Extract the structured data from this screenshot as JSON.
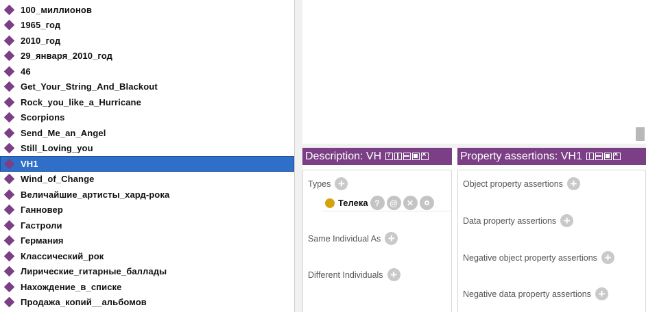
{
  "individuals": [
    {
      "label": "100_миллионов"
    },
    {
      "label": "1965_год"
    },
    {
      "label": "2010_год"
    },
    {
      "label": "29_января_2010_год"
    },
    {
      "label": "46"
    },
    {
      "label": "Get_Your_String_And_Blackout"
    },
    {
      "label": "Rock_you_like_a_Hurricane"
    },
    {
      "label": "Scorpions"
    },
    {
      "label": "Send_Me_an_Angel"
    },
    {
      "label": "Still_Loving_you"
    },
    {
      "label": "VH1",
      "selected": true
    },
    {
      "label": "Wind_of_Change"
    },
    {
      "label": "Величайшие_артисты_хард-рока"
    },
    {
      "label": "Ганновер"
    },
    {
      "label": "Гастроли"
    },
    {
      "label": "Германия"
    },
    {
      "label": "Классический_рок"
    },
    {
      "label": "Лирические_гитарные_баллады"
    },
    {
      "label": "Нахождение_в_списке"
    },
    {
      "label": "Продажа_копий__альбомов"
    }
  ],
  "description_view": {
    "title": "Description: VH",
    "types_label": "Types",
    "type_entry": "Телека",
    "same_individual_label": "Same Individual As",
    "different_individuals_label": "Different Individuals"
  },
  "property_view": {
    "title": "Property assertions: VH1",
    "object_label": "Object property assertions",
    "data_label": "Data property assertions",
    "neg_object_label": "Negative object property assertions",
    "neg_data_label": "Negative data property assertions"
  },
  "colors": {
    "header_purple": "#7b3f85",
    "selection_blue": "#2f6fc9",
    "class_gold": "#d4a310"
  }
}
